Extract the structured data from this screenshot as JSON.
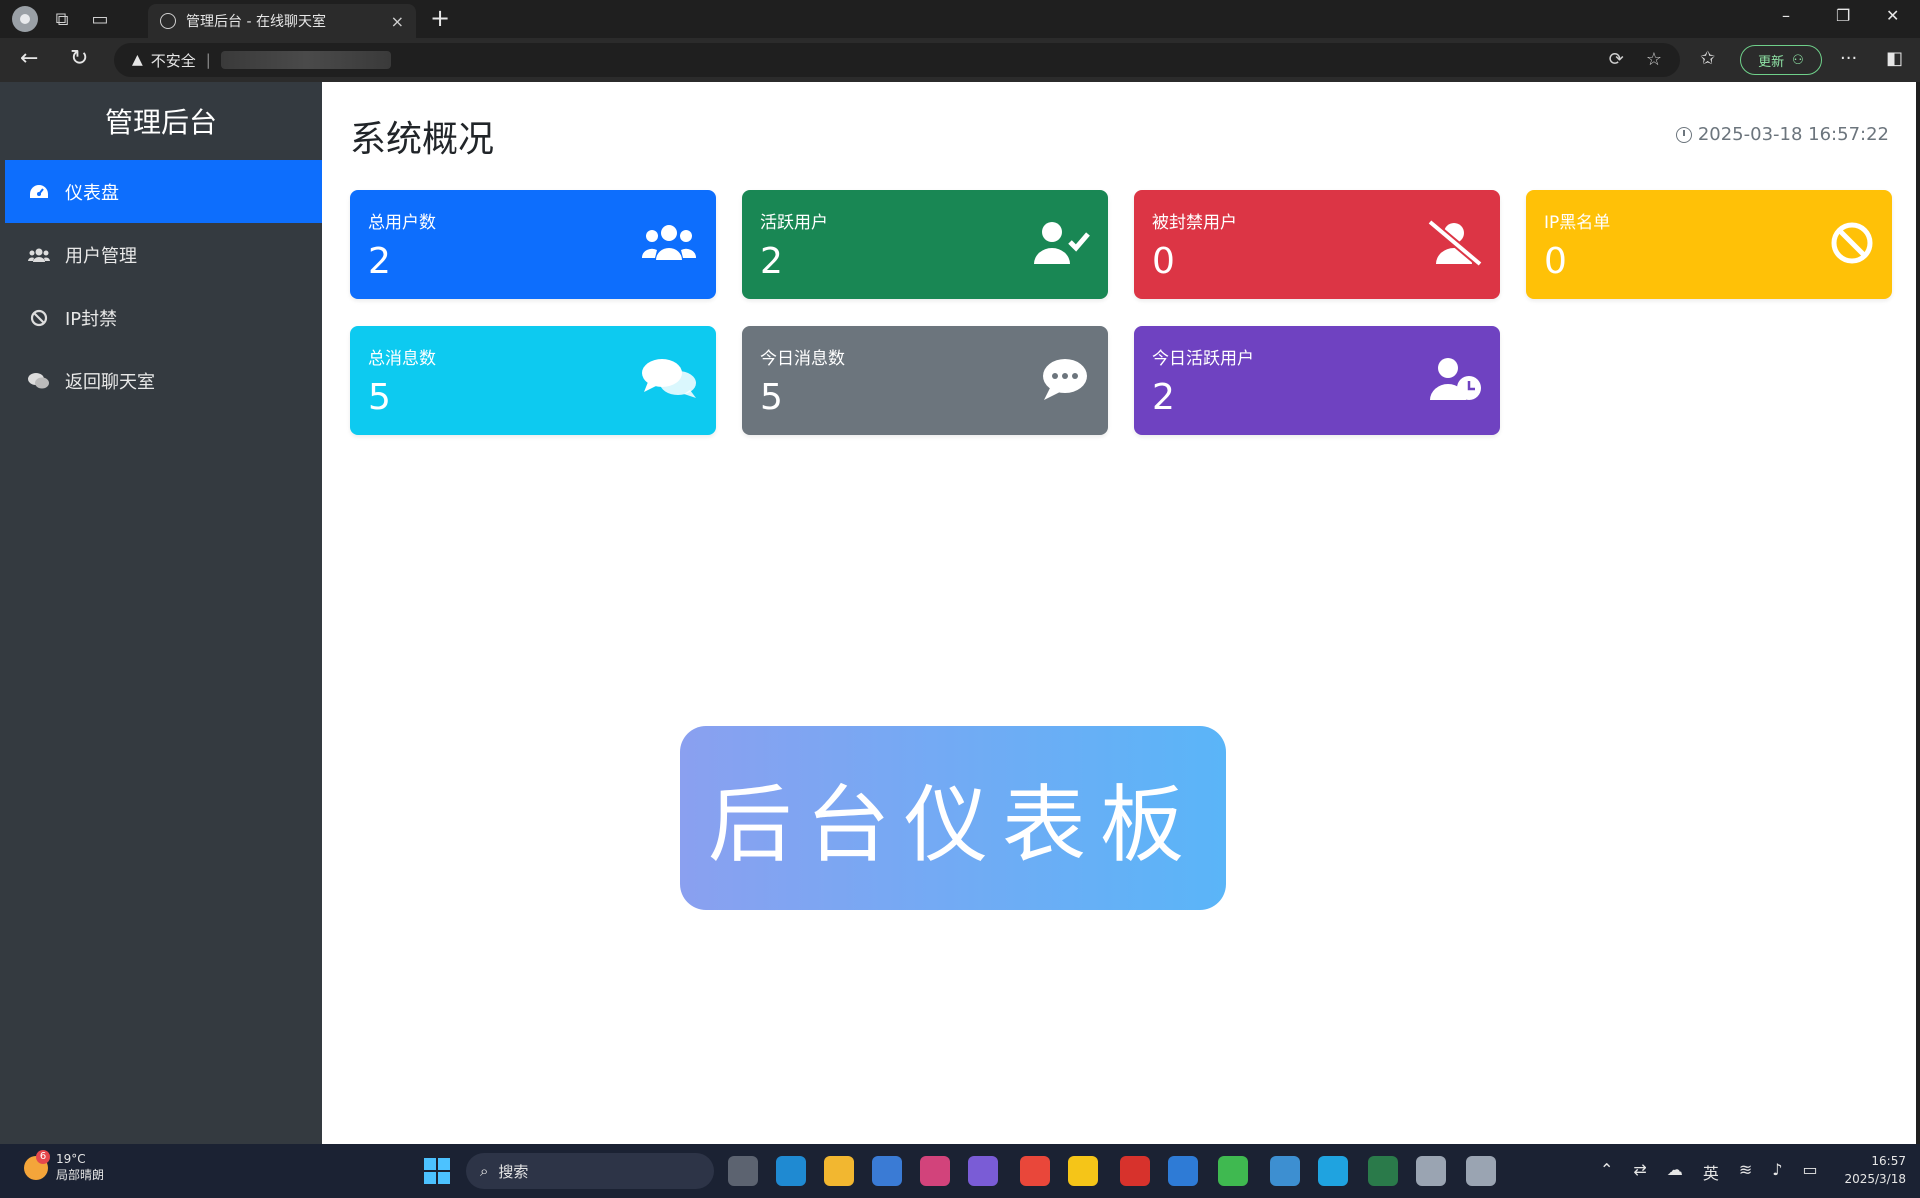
{
  "browser": {
    "tab_title": "管理后台 - 在线聊天室",
    "tab_close": "×",
    "new_tab": "+",
    "security_label": "不安全",
    "update_label": "更新",
    "window_controls": {
      "minimize": "–",
      "maximize": "❐",
      "close": "✕"
    }
  },
  "sidebar": {
    "brand": "管理后台",
    "items": [
      {
        "label": "仪表盘",
        "icon": "dashboard-icon",
        "active": true
      },
      {
        "label": "用户管理",
        "icon": "users-icon",
        "active": false
      },
      {
        "label": "IP封禁",
        "icon": "ban-icon",
        "active": false
      },
      {
        "label": "返回聊天室",
        "icon": "chat-icon",
        "active": false
      }
    ]
  },
  "main": {
    "title": "系统概况",
    "datetime": "2025-03-18 16:57:22",
    "cards": [
      {
        "label": "总用户数",
        "value": "2",
        "color": "#0d6efd",
        "icon": "users-icon"
      },
      {
        "label": "活跃用户",
        "value": "2",
        "color": "#198754",
        "icon": "user-check-icon"
      },
      {
        "label": "被封禁用户",
        "value": "0",
        "color": "#dc3545",
        "icon": "user-slash-icon"
      },
      {
        "label": "IP黑名单",
        "value": "0",
        "color": "#ffc107",
        "icon": "ban-icon"
      },
      {
        "label": "总消息数",
        "value": "5",
        "color": "#0dcaf0",
        "icon": "comments-icon"
      },
      {
        "label": "今日消息数",
        "value": "5",
        "color": "#6c757d",
        "icon": "comment-dots-icon"
      },
      {
        "label": "今日活跃用户",
        "value": "2",
        "color": "#6f42c1",
        "icon": "user-clock-icon"
      }
    ],
    "banner": "后台仪表板"
  },
  "taskbar": {
    "weather_temp": "19°C",
    "weather_desc": "局部晴朗",
    "weather_badge": "6",
    "search_label": "搜索",
    "ime": "英",
    "time": "16:57",
    "date": "2025/3/18"
  }
}
